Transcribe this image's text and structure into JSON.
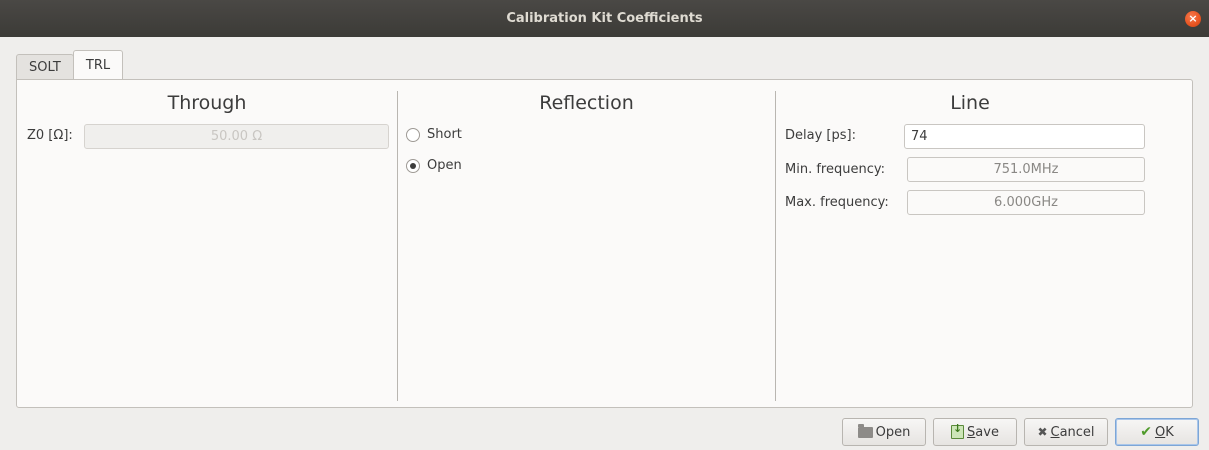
{
  "window": {
    "title": "Calibration Kit Coefficients",
    "close_glyph": "×"
  },
  "tabs": [
    {
      "label": "SOLT",
      "active": false
    },
    {
      "label": "TRL",
      "active": true
    }
  ],
  "through": {
    "title": "Through",
    "z0_label": "Z0 [Ω]:",
    "z0_value": "50.00 Ω"
  },
  "reflection": {
    "title": "Reflection",
    "options": [
      {
        "label": "Short",
        "checked": false
      },
      {
        "label": "Open",
        "checked": true
      }
    ]
  },
  "line": {
    "title": "Line",
    "delay_label": "Delay [ps]:",
    "delay_value": "74",
    "min_freq_label": "Min. frequency:",
    "min_freq_value": "751.0MHz",
    "max_freq_label": "Max. frequency:",
    "max_freq_value": "6.000GHz"
  },
  "buttons": {
    "open": "Open",
    "save_mnemonic": "S",
    "save_rest": "ave",
    "cancel_mnemonic": "C",
    "cancel_rest": "ancel",
    "ok_mnemonic": "O",
    "ok_rest": "K"
  },
  "icons": {
    "open": "folder-icon",
    "save": "save-icon",
    "cancel": "cancel-x-icon",
    "ok": "checkmark-icon"
  },
  "colors": {
    "accent": "#e95420",
    "default_button_border": "#7da6d6"
  }
}
